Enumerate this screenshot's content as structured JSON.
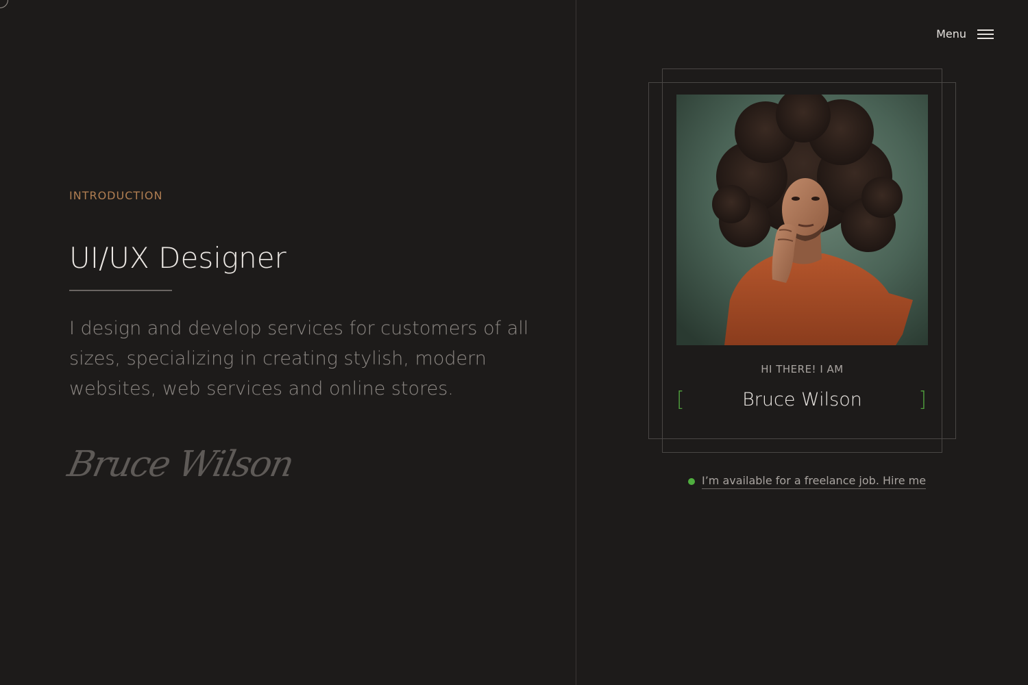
{
  "header": {
    "menu_label": "Menu",
    "menu_icon": "hamburger-icon"
  },
  "intro": {
    "section_label": "INTRODUCTION",
    "title": "UI/UX Designer",
    "description": "I design and develop services for customers of all sizes, specializing in creating stylish, modern websites, web services and online stores.",
    "signature": "Bruce Wilson"
  },
  "card": {
    "greeting": "HI THERE! I AM",
    "name": "Bruce Wilson",
    "bracket_left": "[",
    "bracket_right": "]",
    "accent_color": "#4f9d3c"
  },
  "availability": {
    "text": "I’m available for a freelance job. Hire me",
    "status_color": "#4fae3f"
  },
  "theme": {
    "background": "#1d1b1a",
    "label_color": "#b07e52"
  }
}
